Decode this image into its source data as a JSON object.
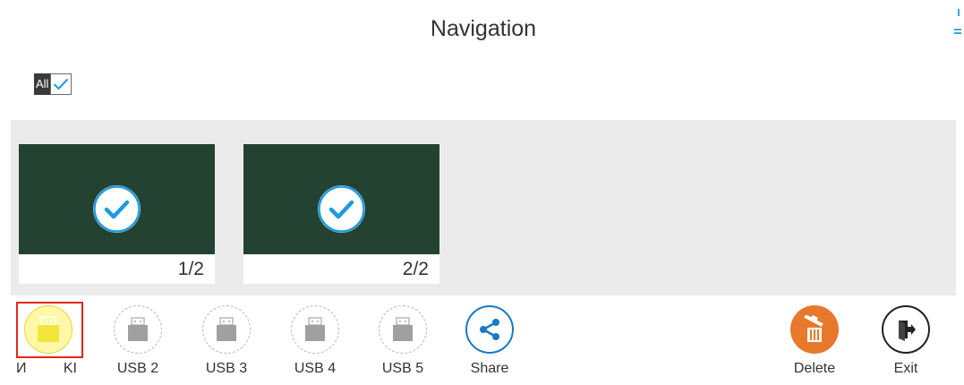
{
  "header": {
    "title": "Navigation",
    "all_label": "All",
    "all_checked": true
  },
  "pages": [
    {
      "label": "1/2",
      "selected": true
    },
    {
      "label": "2/2",
      "selected": true
    }
  ],
  "toolbar": {
    "usb1": {
      "label_left": "И",
      "label_right": "KI",
      "selected": true
    },
    "usb2": {
      "label": "USB 2"
    },
    "usb3": {
      "label": "USB 3"
    },
    "usb4": {
      "label": "USB 4"
    },
    "usb5": {
      "label": "USB 5"
    },
    "share": {
      "label": "Share"
    },
    "delete": {
      "label": "Delete"
    },
    "exit": {
      "label": "Exit"
    }
  },
  "colors": {
    "accent": "#1a79c4",
    "check": "#1e9be0",
    "thumb_bg": "#244231",
    "delete": "#e8782b",
    "selected_frame": "#e0281e",
    "usb_active": "#f2e63c"
  }
}
